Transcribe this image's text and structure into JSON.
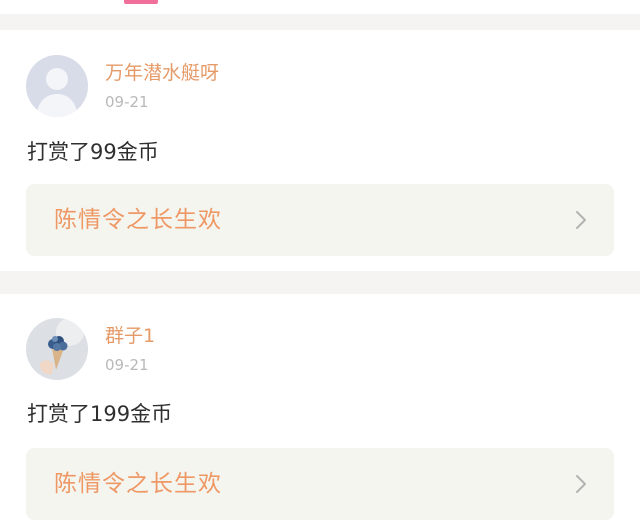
{
  "posts": [
    {
      "username": "万年潜水艇呀",
      "date": "09-21",
      "message": "打赏了99金币",
      "work_title": "陈情令之长生欢",
      "avatar_icon": "default-user-avatar",
      "chevron_icon": "chevron-right-icon"
    },
    {
      "username": "群子1",
      "date": "09-21",
      "message": "打赏了199金币",
      "work_title": "陈情令之长生欢",
      "avatar_icon": "flower-cone-photo",
      "chevron_icon": "chevron-right-icon"
    }
  ],
  "colors": {
    "accent_pink": "#f06f9b",
    "username": "#e59a68",
    "link_text": "#ee9865",
    "date": "#b9b9b9",
    "link_bg": "#f5f5ef"
  }
}
